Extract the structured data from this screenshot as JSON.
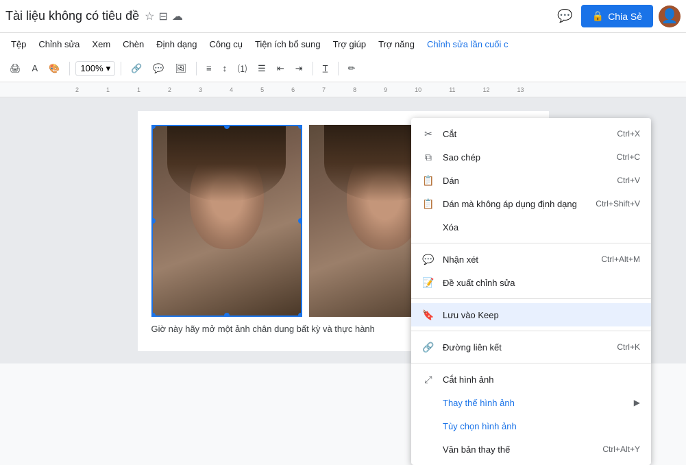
{
  "topbar": {
    "title": "Tài liệu không có tiêu đề",
    "share_label": "Chia Sẻ",
    "lock_icon": "🔒",
    "comment_icon": "💬"
  },
  "menubar": {
    "items": [
      {
        "label": "Tệp"
      },
      {
        "label": "Chỉnh sửa"
      },
      {
        "label": "Xem"
      },
      {
        "label": "Chèn"
      },
      {
        "label": "Định dạng"
      },
      {
        "label": "Công cụ"
      },
      {
        "label": "Tiện ích bổ sung"
      },
      {
        "label": "Trợ giúp"
      },
      {
        "label": "Trợ năng"
      },
      {
        "label": "Chỉnh sửa lần cuối c",
        "highlight": true
      }
    ]
  },
  "toolbar": {
    "zoom": "100%"
  },
  "context_menu": {
    "items": [
      {
        "id": "cut",
        "icon": "✂",
        "label": "Cắt",
        "shortcut": "Ctrl+X"
      },
      {
        "id": "copy",
        "icon": "⧉",
        "label": "Sao chép",
        "shortcut": "Ctrl+C"
      },
      {
        "id": "paste",
        "icon": "📋",
        "label": "Dán",
        "shortcut": "Ctrl+V"
      },
      {
        "id": "paste-plain",
        "icon": "📋",
        "label": "Dán mà không áp dụng định dạng",
        "shortcut": "Ctrl+Shift+V"
      },
      {
        "id": "delete",
        "icon": "",
        "label": "Xóa",
        "shortcut": ""
      },
      {
        "id": "sep1",
        "type": "separator"
      },
      {
        "id": "comment",
        "icon": "💬",
        "label": "Nhận xét",
        "shortcut": "Ctrl+Alt+M"
      },
      {
        "id": "suggest",
        "icon": "📝",
        "label": "Đề xuất chỉnh sửa",
        "shortcut": ""
      },
      {
        "id": "sep2",
        "type": "separator"
      },
      {
        "id": "keep",
        "icon": "🔖",
        "label": "Lưu vào Keep",
        "shortcut": "",
        "active": true
      },
      {
        "id": "sep3",
        "type": "separator"
      },
      {
        "id": "link",
        "icon": "🔗",
        "label": "Đường liên kết",
        "shortcut": "Ctrl+K"
      },
      {
        "id": "sep4",
        "type": "separator"
      },
      {
        "id": "crop",
        "icon": "⤢",
        "label": "Cắt hình ảnh",
        "shortcut": ""
      },
      {
        "id": "replace",
        "icon": "",
        "label": "Thay thế hình ảnh",
        "shortcut": "",
        "submenu": true,
        "color": "blue"
      },
      {
        "id": "options",
        "icon": "",
        "label": "Tùy chọn hình ảnh",
        "shortcut": "",
        "color": "blue"
      },
      {
        "id": "alt-text",
        "icon": "",
        "label": "Văn bản thay thế",
        "shortcut": "Ctrl+Alt+Y"
      }
    ]
  },
  "page": {
    "bottom_text": "Giờ này hãy mở một ảnh chân dung bất kỳ và thực hành"
  }
}
